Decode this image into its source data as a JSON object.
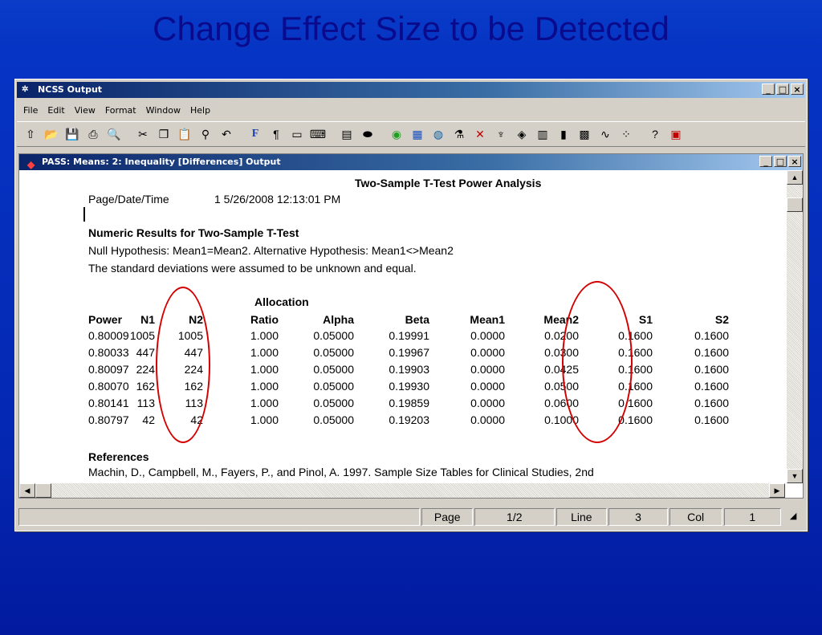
{
  "slide": {
    "title": "Change Effect Size to be Detected"
  },
  "app": {
    "title": "NCSS Output",
    "menu": [
      "File",
      "Edit",
      "View",
      "Format",
      "Window",
      "Help"
    ],
    "menu_underline": [
      "F",
      "E",
      "V",
      "o",
      "W",
      "H"
    ],
    "toolbar_icons": [
      "pointer-icon",
      "open-folder-icon",
      "save-icon",
      "print-icon",
      "print-preview-icon",
      "cut-icon",
      "copy-icon",
      "paste-icon",
      "find-icon",
      "undo-icon",
      "font-icon",
      "paragraph-icon",
      "ruler-icon",
      "keyboard-icon",
      "document-icon",
      "toggle-icon",
      "chart-color-icon",
      "table-icon",
      "globe-icon",
      "flask-icon",
      "x-icon",
      "tree-icon",
      "mra-icon",
      "freq-icon",
      "bar-chart-icon",
      "grid-chart-icon",
      "line-chart-icon",
      "scatter-icon",
      "help-icon",
      "pdf-icon"
    ]
  },
  "report": {
    "window_title": "PASS: Means: 2: Inequality [Differences] Output",
    "heading": "Two-Sample T-Test Power Analysis",
    "page_label": "Page/Date/Time",
    "page_value": "1   5/26/2008 12:13:01 PM",
    "section_title": "Numeric Results for Two-Sample T-Test",
    "null_line": "Null Hypothesis: Mean1=Mean2. Alternative Hypothesis: Mean1<>Mean2",
    "sd_line": "The standard deviations were assumed to be unknown and equal.",
    "allocation_label": "Allocation",
    "columns": [
      "Power",
      "N1",
      "N2",
      "Ratio",
      "Alpha",
      "Beta",
      "Mean1",
      "Mean2",
      "S1",
      "S2"
    ],
    "rows": [
      [
        "0.80009",
        "1005",
        "1005",
        "1.000",
        "0.05000",
        "0.19991",
        "0.0000",
        "0.0200",
        "0.1600",
        "0.1600"
      ],
      [
        "0.80033",
        "447",
        "447",
        "1.000",
        "0.05000",
        "0.19967",
        "0.0000",
        "0.0300",
        "0.1600",
        "0.1600"
      ],
      [
        "0.80097",
        "224",
        "224",
        "1.000",
        "0.05000",
        "0.19903",
        "0.0000",
        "0.0425",
        "0.1600",
        "0.1600"
      ],
      [
        "0.80070",
        "162",
        "162",
        "1.000",
        "0.05000",
        "0.19930",
        "0.0000",
        "0.0500",
        "0.1600",
        "0.1600"
      ],
      [
        "0.80141",
        "113",
        "113",
        "1.000",
        "0.05000",
        "0.19859",
        "0.0000",
        "0.0600",
        "0.1600",
        "0.1600"
      ],
      [
        "0.80797",
        "42",
        "42",
        "1.000",
        "0.05000",
        "0.19203",
        "0.0000",
        "0.1000",
        "0.1600",
        "0.1600"
      ]
    ],
    "references_label": "References",
    "reference_line": "Machin, D., Campbell, M., Fayers, P., and Pinol, A. 1997. Sample Size Tables for Clinical Studies, 2nd"
  },
  "status": {
    "page_label": "Page",
    "page_value": "1/2",
    "line_label": "Line",
    "line_value": "3",
    "col_label": "Col",
    "col_value": "1"
  }
}
